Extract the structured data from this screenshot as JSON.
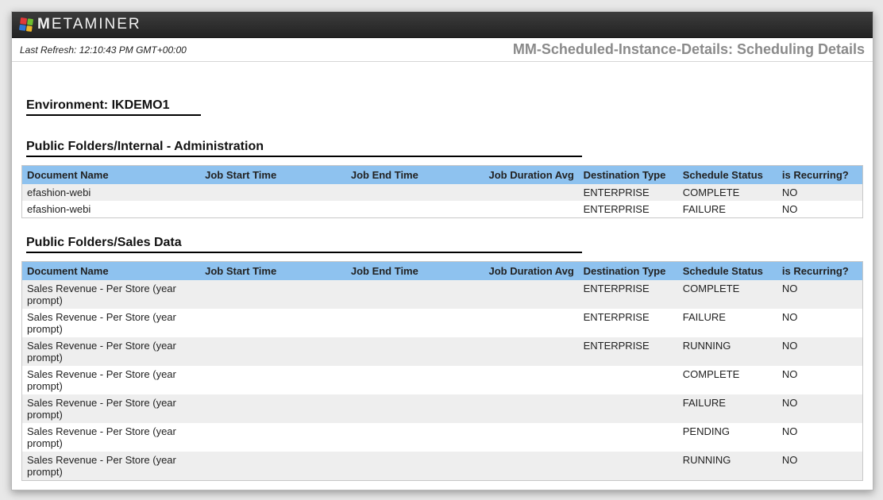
{
  "brand": {
    "name_strong": "M",
    "name_rest": "ETAMINER"
  },
  "last_refresh_label": "Last Refresh:",
  "last_refresh_value": "12:10:43 PM GMT+00:00",
  "doc_title": "MM-Scheduled-Instance-Details: Scheduling Details",
  "environment_label": "Environment:",
  "environment_value": "IKDEMO1",
  "columns": {
    "doc": "Document Name",
    "start": "Job Start Time",
    "end": "Job End Time",
    "dur": "Job Duration Avg",
    "dest": "Destination Type",
    "stat": "Schedule Status",
    "recur": "is Recurring?"
  },
  "sections": [
    {
      "title": "Public Folders/Internal - Administration",
      "rows": [
        {
          "doc": "efashion-webi",
          "start": "",
          "end": "",
          "dur": "",
          "dest": "ENTERPRISE",
          "stat": "COMPLETE",
          "recur": "NO"
        },
        {
          "doc": "efashion-webi",
          "start": "",
          "end": "",
          "dur": "",
          "dest": "ENTERPRISE",
          "stat": "FAILURE",
          "recur": "NO"
        }
      ]
    },
    {
      "title": "Public Folders/Sales Data",
      "rows": [
        {
          "doc": "Sales Revenue - Per Store (year prompt)",
          "start": "",
          "end": "",
          "dur": "",
          "dest": "ENTERPRISE",
          "stat": "COMPLETE",
          "recur": "NO"
        },
        {
          "doc": "Sales Revenue - Per Store (year prompt)",
          "start": "",
          "end": "",
          "dur": "",
          "dest": "ENTERPRISE",
          "stat": "FAILURE",
          "recur": "NO"
        },
        {
          "doc": "Sales Revenue - Per Store (year prompt)",
          "start": "",
          "end": "",
          "dur": "",
          "dest": "ENTERPRISE",
          "stat": "RUNNING",
          "recur": "NO"
        },
        {
          "doc": "Sales Revenue - Per Store (year prompt)",
          "start": "",
          "end": "",
          "dur": "",
          "dest": "",
          "stat": "COMPLETE",
          "recur": "NO"
        },
        {
          "doc": "Sales Revenue - Per Store (year prompt)",
          "start": "",
          "end": "",
          "dur": "",
          "dest": "",
          "stat": "FAILURE",
          "recur": "NO"
        },
        {
          "doc": "Sales Revenue - Per Store (year prompt)",
          "start": "",
          "end": "",
          "dur": "",
          "dest": "",
          "stat": "PENDING",
          "recur": "NO"
        },
        {
          "doc": "Sales Revenue - Per Store (year prompt)",
          "start": "",
          "end": "",
          "dur": "",
          "dest": "",
          "stat": "RUNNING",
          "recur": "NO"
        }
      ]
    }
  ]
}
